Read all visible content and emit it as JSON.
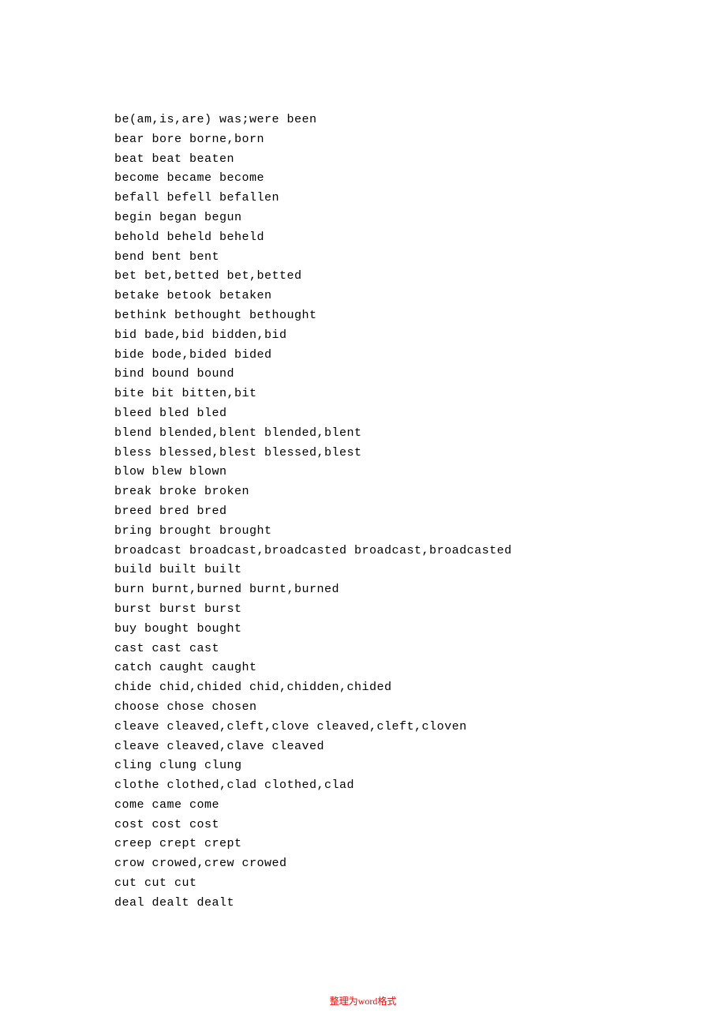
{
  "verbs": [
    "be(am,is,are) was;were been",
    "bear bore borne,born",
    "beat beat beaten",
    "become became become",
    "befall befell befallen",
    "begin began begun",
    "behold beheld beheld",
    "bend bent bent",
    "bet bet,betted bet,betted",
    "betake betook betaken",
    "bethink bethought bethought",
    "bid bade,bid bidden,bid",
    "bide bode,bided bided",
    "bind bound bound",
    "bite bit bitten,bit",
    "bleed bled bled",
    "blend blended,blent blended,blent",
    "bless blessed,blest blessed,blest",
    "blow blew blown",
    "break broke broken",
    "breed bred bred",
    "bring brought brought",
    "broadcast broadcast,broadcasted broadcast,broadcasted",
    "build built built",
    "burn burnt,burned burnt,burned",
    "burst burst burst",
    "buy bought bought",
    "cast cast cast",
    "catch caught caught",
    "chide chid,chided chid,chidden,chided",
    "choose chose chosen",
    "cleave cleaved,cleft,clove cleaved,cleft,cloven",
    "cleave cleaved,clave cleaved",
    "cling clung clung",
    "clothe clothed,clad clothed,clad",
    "come came come",
    "cost cost cost",
    "creep crept crept",
    "crow crowed,crew crowed",
    "cut cut cut",
    "deal dealt dealt"
  ],
  "footer": {
    "prefix": "整理为",
    "word": "word",
    "suffix": "格式"
  }
}
